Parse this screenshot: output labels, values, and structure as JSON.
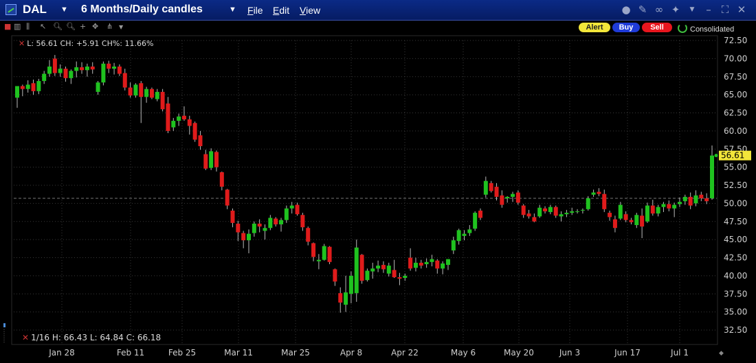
{
  "window": {
    "symbol": "DAL",
    "period": "6 Months/Daily candles",
    "menus": [
      "File",
      "Edit",
      "View"
    ]
  },
  "toolbar": {
    "alert": "Alert",
    "buy": "Buy",
    "sell": "Sell",
    "consolidated": "Consolidated"
  },
  "info": {
    "top": "L: 56.61  CH: +5.91  CH%: 11.66%",
    "bottom": "1/16   H: 66.43   L: 64.84   C: 66.18"
  },
  "colors": {
    "up": "#1fc21f",
    "down": "#e01b1b",
    "grid": "#3a3a3a",
    "axis_text": "#d0d0d0",
    "last_price_bg": "#f2e63a"
  },
  "chart_data": {
    "type": "candlestick",
    "ylim": [
      32.5,
      72.5
    ],
    "yticks": [
      "72.50",
      "70.00",
      "67.50",
      "65.00",
      "62.50",
      "60.00",
      "57.50",
      "55.00",
      "52.50",
      "50.00",
      "47.50",
      "45.00",
      "42.50",
      "40.00",
      "37.50",
      "35.00",
      "32.50"
    ],
    "xticks": [
      "Jan 28",
      "Feb 11",
      "Feb 25",
      "Mar 11",
      "Mar 25",
      "Apr 8",
      "Apr 22",
      "May 6",
      "May 20",
      "Jun 3",
      "Jun 17",
      "Jul 1"
    ],
    "last_price": "56.61",
    "reference_level": 50.7,
    "candles": [
      {
        "o": 64.6,
        "h": 66.1,
        "l": 63.2,
        "c": 66.2
      },
      {
        "o": 66.2,
        "h": 66.4,
        "l": 64.8,
        "c": 65.8
      },
      {
        "o": 65.8,
        "h": 67.0,
        "l": 65.3,
        "c": 66.4
      },
      {
        "o": 66.6,
        "h": 67.1,
        "l": 65.0,
        "c": 65.5
      },
      {
        "o": 65.5,
        "h": 67.2,
        "l": 65.1,
        "c": 66.9
      },
      {
        "o": 66.9,
        "h": 68.3,
        "l": 66.5,
        "c": 67.9
      },
      {
        "o": 67.9,
        "h": 69.8,
        "l": 67.5,
        "c": 68.9
      },
      {
        "o": 70.0,
        "h": 70.5,
        "l": 67.6,
        "c": 68.0
      },
      {
        "o": 68.0,
        "h": 69.2,
        "l": 67.5,
        "c": 68.6
      },
      {
        "o": 68.6,
        "h": 68.9,
        "l": 66.8,
        "c": 67.3
      },
      {
        "o": 67.3,
        "h": 68.5,
        "l": 66.5,
        "c": 68.3
      },
      {
        "o": 68.3,
        "h": 69.6,
        "l": 67.4,
        "c": 68.8
      },
      {
        "o": 68.8,
        "h": 69.5,
        "l": 67.9,
        "c": 68.4
      },
      {
        "o": 68.4,
        "h": 69.3,
        "l": 67.5,
        "c": 68.9
      },
      {
        "o": 68.9,
        "h": 69.5,
        "l": 67.9,
        "c": 68.5
      },
      {
        "o": 65.4,
        "h": 66.9,
        "l": 65.0,
        "c": 66.7
      },
      {
        "o": 66.7,
        "h": 69.6,
        "l": 66.3,
        "c": 69.3
      },
      {
        "o": 69.3,
        "h": 69.7,
        "l": 68.0,
        "c": 68.6
      },
      {
        "o": 68.6,
        "h": 69.4,
        "l": 67.8,
        "c": 68.9
      },
      {
        "o": 68.9,
        "h": 69.2,
        "l": 67.6,
        "c": 67.9
      },
      {
        "o": 68.0,
        "h": 68.6,
        "l": 65.6,
        "c": 66.0
      },
      {
        "o": 66.0,
        "h": 66.7,
        "l": 64.6,
        "c": 64.9
      },
      {
        "o": 64.9,
        "h": 66.6,
        "l": 64.6,
        "c": 66.4
      },
      {
        "o": 66.6,
        "h": 66.9,
        "l": 61.1,
        "c": 64.7
      },
      {
        "o": 64.7,
        "h": 66.1,
        "l": 63.9,
        "c": 65.8
      },
      {
        "o": 65.8,
        "h": 66.0,
        "l": 64.4,
        "c": 64.6
      },
      {
        "o": 64.4,
        "h": 65.8,
        "l": 64.1,
        "c": 65.4
      },
      {
        "o": 65.4,
        "h": 65.8,
        "l": 62.7,
        "c": 63.0
      },
      {
        "o": 63.8,
        "h": 64.7,
        "l": 59.7,
        "c": 60.0
      },
      {
        "o": 60.5,
        "h": 61.8,
        "l": 60.0,
        "c": 61.4
      },
      {
        "o": 61.4,
        "h": 62.4,
        "l": 60.7,
        "c": 62.0
      },
      {
        "o": 62.1,
        "h": 63.4,
        "l": 61.4,
        "c": 61.6
      },
      {
        "o": 61.6,
        "h": 62.1,
        "l": 59.5,
        "c": 60.7
      },
      {
        "o": 61.1,
        "h": 61.3,
        "l": 58.5,
        "c": 58.8
      },
      {
        "o": 59.4,
        "h": 60.0,
        "l": 57.4,
        "c": 57.9
      },
      {
        "o": 56.8,
        "h": 57.4,
        "l": 54.6,
        "c": 54.8
      },
      {
        "o": 54.9,
        "h": 57.6,
        "l": 54.6,
        "c": 57.2
      },
      {
        "o": 57.1,
        "h": 57.3,
        "l": 54.4,
        "c": 55.0
      },
      {
        "o": 54.3,
        "h": 54.4,
        "l": 51.8,
        "c": 52.3
      },
      {
        "o": 51.9,
        "h": 52.0,
        "l": 49.2,
        "c": 49.7
      },
      {
        "o": 49.0,
        "h": 49.3,
        "l": 46.7,
        "c": 47.3
      },
      {
        "o": 47.2,
        "h": 47.6,
        "l": 44.8,
        "c": 46.0
      },
      {
        "o": 45.9,
        "h": 46.2,
        "l": 43.8,
        "c": 44.9
      },
      {
        "o": 44.9,
        "h": 46.4,
        "l": 43.1,
        "c": 45.8
      },
      {
        "o": 45.9,
        "h": 47.5,
        "l": 45.4,
        "c": 47.2
      },
      {
        "o": 47.2,
        "h": 47.8,
        "l": 46.0,
        "c": 46.8
      },
      {
        "o": 46.2,
        "h": 47.1,
        "l": 45.0,
        "c": 46.6
      },
      {
        "o": 46.6,
        "h": 48.4,
        "l": 46.3,
        "c": 48.0
      },
      {
        "o": 47.9,
        "h": 48.1,
        "l": 46.8,
        "c": 47.1
      },
      {
        "o": 47.1,
        "h": 48.0,
        "l": 46.1,
        "c": 47.7
      },
      {
        "o": 47.7,
        "h": 49.7,
        "l": 47.3,
        "c": 49.3
      },
      {
        "o": 49.3,
        "h": 50.2,
        "l": 48.6,
        "c": 49.7
      },
      {
        "o": 49.8,
        "h": 50.1,
        "l": 48.3,
        "c": 48.5
      },
      {
        "o": 48.4,
        "h": 48.7,
        "l": 46.2,
        "c": 46.7
      },
      {
        "o": 46.6,
        "h": 46.8,
        "l": 44.2,
        "c": 44.7
      },
      {
        "o": 44.5,
        "h": 44.6,
        "l": 42.0,
        "c": 42.6
      },
      {
        "o": 42.0,
        "h": 43.0,
        "l": 40.9,
        "c": 42.2
      },
      {
        "o": 42.2,
        "h": 44.4,
        "l": 42.1,
        "c": 44.1
      },
      {
        "o": 44.0,
        "h": 44.1,
        "l": 41.6,
        "c": 41.9
      },
      {
        "o": 40.9,
        "h": 41.0,
        "l": 38.6,
        "c": 39.2
      },
      {
        "o": 37.6,
        "h": 38.4,
        "l": 34.9,
        "c": 36.3
      },
      {
        "o": 36.0,
        "h": 40.0,
        "l": 35.0,
        "c": 37.7
      },
      {
        "o": 37.5,
        "h": 40.6,
        "l": 36.2,
        "c": 40.0
      },
      {
        "o": 37.6,
        "h": 45.0,
        "l": 36.4,
        "c": 43.9
      },
      {
        "o": 42.9,
        "h": 43.0,
        "l": 38.9,
        "c": 39.3
      },
      {
        "o": 39.4,
        "h": 41.0,
        "l": 39.2,
        "c": 40.7
      },
      {
        "o": 40.6,
        "h": 41.8,
        "l": 39.6,
        "c": 41.0
      },
      {
        "o": 41.0,
        "h": 42.1,
        "l": 40.5,
        "c": 41.4
      },
      {
        "o": 41.5,
        "h": 42.0,
        "l": 40.4,
        "c": 40.9
      },
      {
        "o": 40.3,
        "h": 41.8,
        "l": 39.9,
        "c": 41.4
      },
      {
        "o": 40.8,
        "h": 42.2,
        "l": 39.7,
        "c": 39.8
      },
      {
        "o": 39.8,
        "h": 40.4,
        "l": 38.7,
        "c": 39.6
      },
      {
        "o": 39.7,
        "h": 40.3,
        "l": 39.3,
        "c": 40.0
      },
      {
        "o": 42.5,
        "h": 43.8,
        "l": 40.7,
        "c": 41.0
      },
      {
        "o": 41.1,
        "h": 42.5,
        "l": 40.6,
        "c": 41.8
      },
      {
        "o": 41.8,
        "h": 42.2,
        "l": 41.0,
        "c": 41.4
      },
      {
        "o": 41.6,
        "h": 42.4,
        "l": 41.1,
        "c": 41.9
      },
      {
        "o": 41.9,
        "h": 42.9,
        "l": 41.3,
        "c": 42.3
      },
      {
        "o": 42.1,
        "h": 42.3,
        "l": 40.3,
        "c": 41.0
      },
      {
        "o": 41.0,
        "h": 42.0,
        "l": 40.2,
        "c": 41.7
      },
      {
        "o": 41.5,
        "h": 42.3,
        "l": 40.8,
        "c": 42.3
      },
      {
        "o": 43.5,
        "h": 45.4,
        "l": 43.0,
        "c": 44.9
      },
      {
        "o": 44.8,
        "h": 46.5,
        "l": 44.3,
        "c": 46.3
      },
      {
        "o": 45.5,
        "h": 46.3,
        "l": 44.9,
        "c": 45.8
      },
      {
        "o": 45.9,
        "h": 47.0,
        "l": 45.5,
        "c": 46.4
      },
      {
        "o": 46.5,
        "h": 48.9,
        "l": 46.2,
        "c": 48.7
      },
      {
        "o": 49.0,
        "h": 49.3,
        "l": 47.7,
        "c": 48.0
      },
      {
        "o": 51.2,
        "h": 53.7,
        "l": 50.8,
        "c": 53.1
      },
      {
        "o": 52.8,
        "h": 53.1,
        "l": 51.5,
        "c": 51.7
      },
      {
        "o": 52.3,
        "h": 52.8,
        "l": 50.4,
        "c": 50.9
      },
      {
        "o": 51.1,
        "h": 51.8,
        "l": 49.4,
        "c": 49.8
      },
      {
        "o": 50.7,
        "h": 51.0,
        "l": 50.1,
        "c": 50.9
      },
      {
        "o": 50.9,
        "h": 51.6,
        "l": 50.2,
        "c": 51.3
      },
      {
        "o": 51.5,
        "h": 51.8,
        "l": 49.8,
        "c": 50.1
      },
      {
        "o": 49.7,
        "h": 49.9,
        "l": 48.0,
        "c": 48.4
      },
      {
        "o": 48.6,
        "h": 49.1,
        "l": 47.9,
        "c": 48.2
      },
      {
        "o": 48.1,
        "h": 48.6,
        "l": 47.4,
        "c": 47.5
      },
      {
        "o": 48.2,
        "h": 49.8,
        "l": 48.0,
        "c": 49.4
      },
      {
        "o": 49.3,
        "h": 49.6,
        "l": 48.6,
        "c": 48.9
      },
      {
        "o": 48.8,
        "h": 49.8,
        "l": 48.5,
        "c": 49.5
      },
      {
        "o": 49.5,
        "h": 49.7,
        "l": 48.0,
        "c": 48.3
      },
      {
        "o": 48.2,
        "h": 48.9,
        "l": 47.5,
        "c": 48.5
      },
      {
        "o": 48.5,
        "h": 49.1,
        "l": 48.1,
        "c": 48.7
      },
      {
        "o": 48.7,
        "h": 49.4,
        "l": 48.4,
        "c": 48.9
      },
      {
        "o": 48.9,
        "h": 49.2,
        "l": 48.6,
        "c": 48.9
      },
      {
        "o": 49.0,
        "h": 49.3,
        "l": 48.6,
        "c": 49.1
      },
      {
        "o": 49.2,
        "h": 51.0,
        "l": 49.0,
        "c": 50.7
      },
      {
        "o": 51.2,
        "h": 51.9,
        "l": 50.9,
        "c": 51.5
      },
      {
        "o": 51.6,
        "h": 52.1,
        "l": 51.0,
        "c": 51.3
      },
      {
        "o": 51.3,
        "h": 51.9,
        "l": 48.8,
        "c": 49.2
      },
      {
        "o": 48.7,
        "h": 49.0,
        "l": 47.6,
        "c": 48.1
      },
      {
        "o": 47.8,
        "h": 48.3,
        "l": 46.0,
        "c": 46.6
      },
      {
        "o": 47.9,
        "h": 50.2,
        "l": 47.7,
        "c": 49.8
      },
      {
        "o": 48.5,
        "h": 48.9,
        "l": 47.4,
        "c": 47.7
      },
      {
        "o": 47.7,
        "h": 48.0,
        "l": 47.1,
        "c": 47.4
      },
      {
        "o": 47.0,
        "h": 48.7,
        "l": 46.6,
        "c": 48.4
      },
      {
        "o": 48.3,
        "h": 49.3,
        "l": 45.2,
        "c": 46.8
      },
      {
        "o": 47.5,
        "h": 50.1,
        "l": 47.3,
        "c": 49.7
      },
      {
        "o": 49.7,
        "h": 50.5,
        "l": 48.3,
        "c": 48.6
      },
      {
        "o": 48.6,
        "h": 49.8,
        "l": 48.2,
        "c": 49.5
      },
      {
        "o": 49.5,
        "h": 50.2,
        "l": 48.8,
        "c": 49.9
      },
      {
        "o": 49.9,
        "h": 50.4,
        "l": 48.9,
        "c": 49.3
      },
      {
        "o": 49.3,
        "h": 50.1,
        "l": 48.1,
        "c": 49.8
      },
      {
        "o": 49.9,
        "h": 50.8,
        "l": 49.5,
        "c": 50.2
      },
      {
        "o": 50.3,
        "h": 51.2,
        "l": 49.8,
        "c": 50.9
      },
      {
        "o": 50.9,
        "h": 51.5,
        "l": 49.2,
        "c": 49.7
      },
      {
        "o": 50.0,
        "h": 51.8,
        "l": 49.6,
        "c": 51.1
      },
      {
        "o": 51.2,
        "h": 51.6,
        "l": 50.3,
        "c": 50.7
      },
      {
        "o": 50.7,
        "h": 51.4,
        "l": 49.9,
        "c": 50.3
      },
      {
        "o": 50.7,
        "h": 58.0,
        "l": 50.5,
        "c": 56.61
      }
    ]
  }
}
